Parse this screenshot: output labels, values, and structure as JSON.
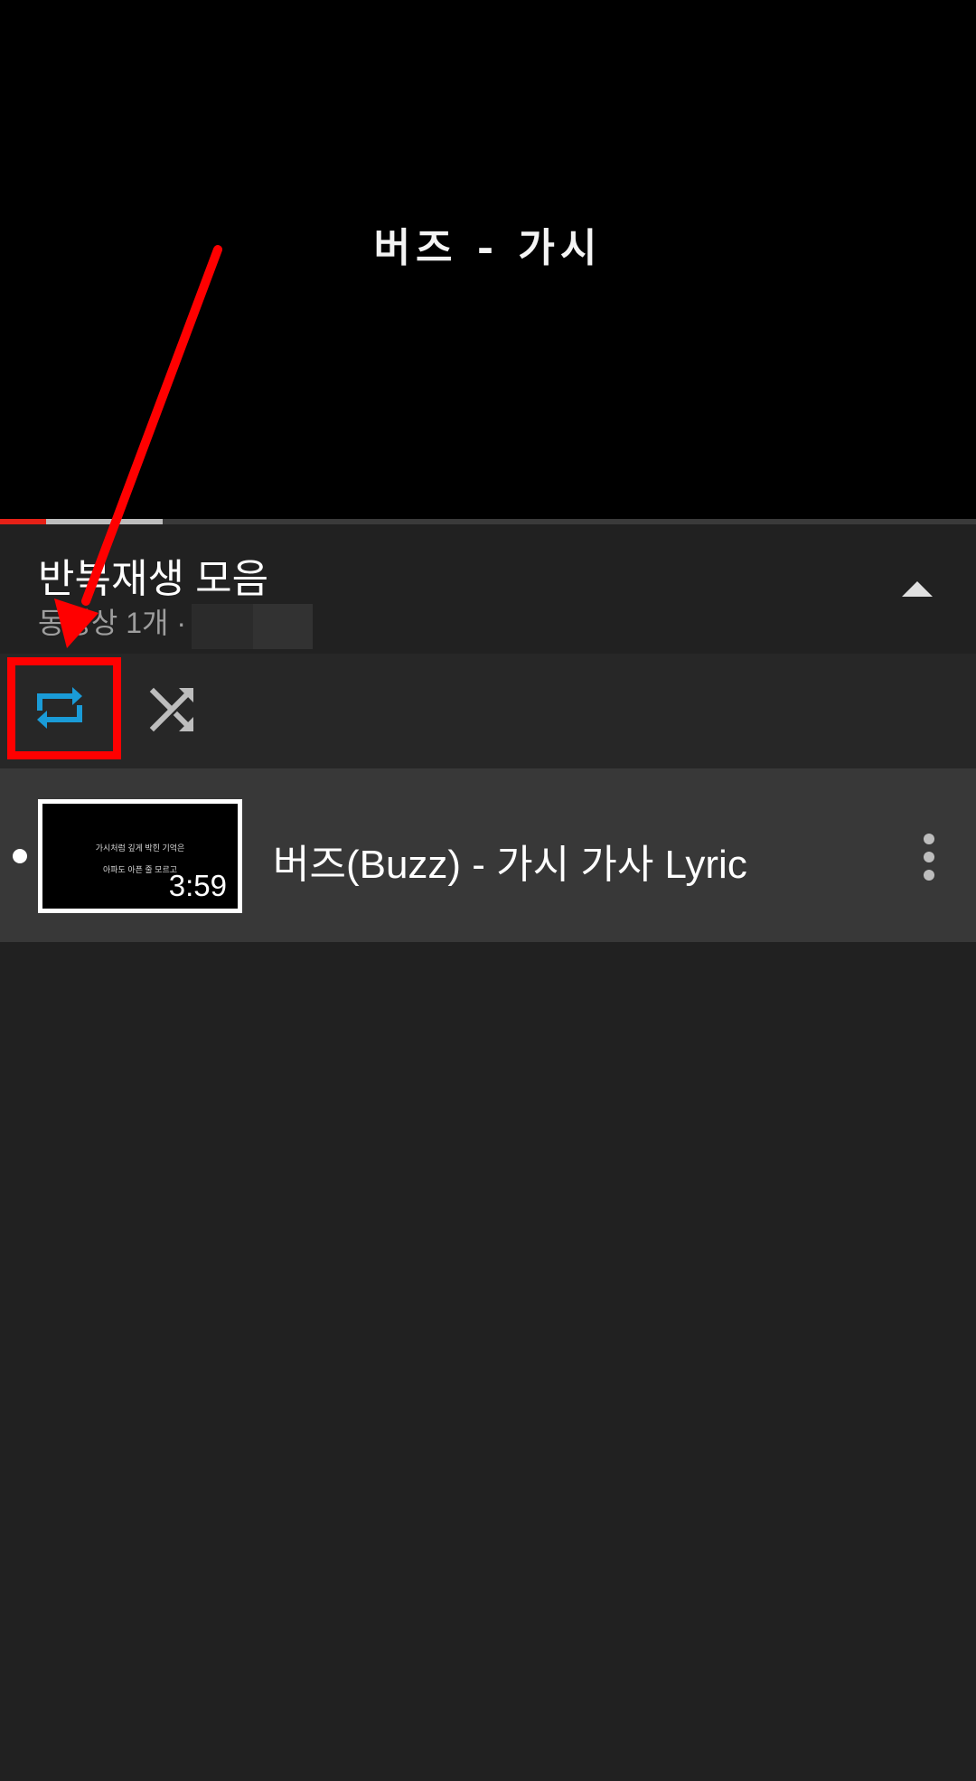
{
  "player": {
    "video_title": "버즈 - 가시",
    "progress_played": 0.047,
    "progress_buffered": 0.167
  },
  "playlist": {
    "title": "반복재생 모음",
    "subtitle": "동영상 1개 ·"
  },
  "controls": {
    "loop_active": true,
    "loop_icon": "repeat-icon",
    "shuffle_icon": "shuffle-icon",
    "collapse_icon": "chevron-up-icon"
  },
  "items": [
    {
      "title": "버즈(Buzz) - 가시 가사 Lyric",
      "duration": "3:59",
      "thumbnail_lines": [
        "가시처럼 깊게 박힌 기억은",
        "아파도 아픈 줄 모르고"
      ],
      "now_playing": true
    }
  ],
  "colors": {
    "loop_active": "#1a9bd7",
    "progress_played": "#e62117",
    "annotation": "#ff0000"
  }
}
